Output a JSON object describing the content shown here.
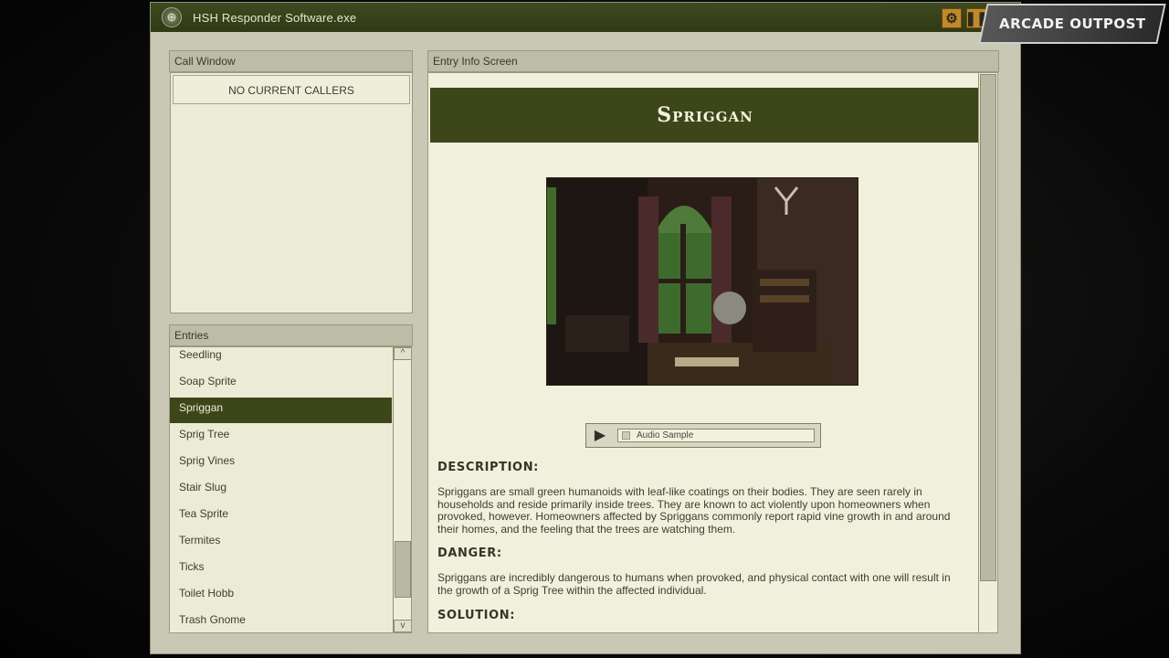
{
  "window": {
    "title": "HSH Responder Software.exe"
  },
  "watermark": {
    "text": "ARCADE OUTPOST"
  },
  "call_window": {
    "header": "Call Window",
    "status": "NO CURRENT CALLERS"
  },
  "entries_panel": {
    "header": "Entries",
    "items": [
      "Seedling",
      "Soap Sprite",
      "Spriggan",
      "Sprig Tree",
      "Sprig Vines",
      "Stair Slug",
      "Tea Sprite",
      "Termites",
      "Ticks",
      "Toilet Hobb",
      "Trash Gnome"
    ],
    "selected": "Spriggan"
  },
  "entry_info": {
    "header": "Entry Info Screen",
    "title": "Spriggan",
    "audio_label": "Audio Sample",
    "description_title": "DESCRIPTION:",
    "description": "Spriggans are small green humanoids with leaf-like coatings on their bodies. They are seen rarely in households and reside primarily inside trees. They are known to act violently upon homeowners when provoked, however. Homeowners affected by Spriggans commonly report rapid vine growth in and around their homes, and the feeling that the trees are watching them.",
    "danger_title": "DANGER:",
    "danger": "Spriggans are incredibly dangerous to humans when provoked, and physical contact with one will result in the growth of a Sprig Tree within the affected individual.",
    "solution_title": "SOLUTION:"
  },
  "icons": {
    "settings": "gear-icon",
    "pause": "pause-icon",
    "play": "play-icon",
    "app": "globe-icon"
  },
  "colors": {
    "titlebar": "#3f4a1f",
    "accent_green": "#3d4619",
    "panel_bg": "#ecebd6",
    "button_orange": "#c08a2a"
  }
}
